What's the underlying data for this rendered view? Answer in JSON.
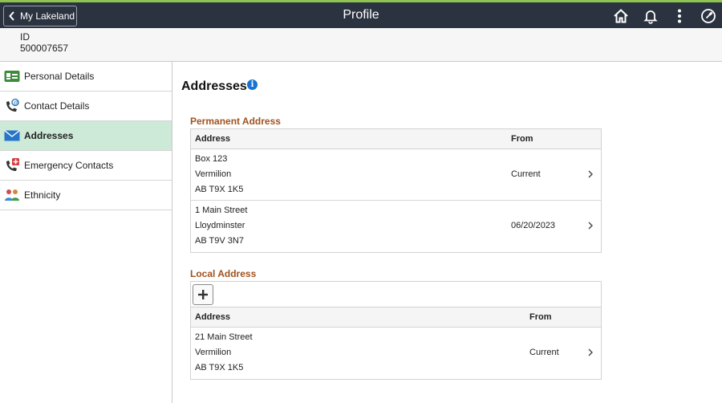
{
  "header": {
    "back_label": "My Lakeland",
    "title": "Profile",
    "icons": [
      "home-icon",
      "bell-icon",
      "more-vertical-icon",
      "compass-icon"
    ]
  },
  "id_bar": {
    "label": "ID",
    "value": "500007657"
  },
  "sidebar": {
    "items": [
      {
        "label": "Personal Details",
        "icon": "id-card-icon"
      },
      {
        "label": "Contact Details",
        "icon": "phone-at-icon"
      },
      {
        "label": "Addresses",
        "icon": "envelope-icon",
        "active": true
      },
      {
        "label": "Emergency Contacts",
        "icon": "phone-plus-icon"
      },
      {
        "label": "Ethnicity",
        "icon": "people-icon"
      }
    ]
  },
  "main": {
    "title": "Addresses",
    "info_glyph": "i",
    "permanent": {
      "title": "Permanent Address",
      "col_address": "Address",
      "col_from": "From",
      "rows": [
        {
          "line1": "Box 123",
          "line2": "Vermilion",
          "line3": "AB T9X 1K5",
          "from": "Current"
        },
        {
          "line1": "1 Main Street",
          "line2": "Lloydminster",
          "line3": "AB T9V 3N7",
          "from": "06/20/2023"
        }
      ]
    },
    "local": {
      "title": "Local Address",
      "col_address": "Address",
      "col_from": "From",
      "rows": [
        {
          "line1": "21 Main Street",
          "line2": "Vermilion",
          "line3": "AB T9X 1K5",
          "from": "Current"
        }
      ]
    }
  },
  "colors": {
    "topbar": "#2b3341",
    "accent_stripe": "#8fc451",
    "active_bg": "#cde9d8",
    "group_title": "#a0521f",
    "info": "#1673d1"
  }
}
